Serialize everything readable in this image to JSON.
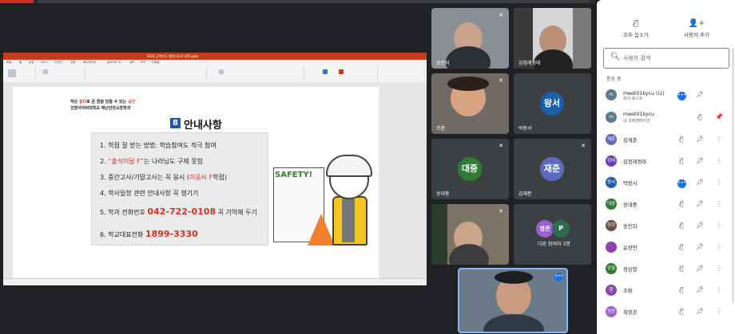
{
  "shared_screen": {
    "ppt_title": "2022_2학년도 행정사무과 개혁.pptx",
    "ribbon_tabs": [
      "파일",
      "홈",
      "삽입",
      "그리기",
      "디자인",
      "전환",
      "애니메이션",
      "슬라이드 쇼",
      "검토",
      "보기",
      "도움말"
    ],
    "slide": {
      "top_line1_a": "작은 ",
      "top_line1_red1": "흥미",
      "top_line1_b": "로 큰 꿈을 담을 수 있는 ",
      "top_line1_red2": "공간",
      "top_line2": "건양사이버대학교 재난안전소방학과",
      "section_number": "8",
      "title": "안내사항",
      "items": [
        {
          "n": "1.",
          "text": "학점 잘 받는 방법: 학습참여도 적극 참여"
        },
        {
          "n": "2.",
          "pre": "“출석미달 F”",
          "text": "는 나라님도 구제 못함"
        },
        {
          "n": "3.",
          "text": "중간고사/기말고사는 꼭 응시 (",
          "red": "미응시 F",
          "post": "학점)"
        },
        {
          "n": "4.",
          "text": "학사일정 관련 안내사항 꼭 챙기기"
        },
        {
          "n": "5.",
          "text": "학과 전화번호 ",
          "big": "042-722-0108",
          "post": " 꼭 기억해 두기"
        },
        {
          "n": "6.",
          "text": "학교대표전화 ",
          "big": "1899-3330"
        }
      ],
      "board_text": "SAFETY!"
    }
  },
  "tiles": [
    {
      "name": "송민석",
      "muted": true
    },
    {
      "name": "김정래정태",
      "muted": false
    },
    {
      "name": "조환",
      "muted": true
    },
    {
      "name": "박왕서",
      "muted": false,
      "avatar": "왕서",
      "avatar_color": "#1a5fa8"
    },
    {
      "name": "송대중",
      "muted": true,
      "avatar": "대중",
      "avatar_color": "#2e7d32"
    },
    {
      "name": "김재준",
      "muted": false,
      "avatar": "재준",
      "avatar_color": "#5c6bc0"
    },
    {
      "name": "",
      "muted": true
    },
    {
      "name": "다른 참여자 3명",
      "avatar_a": "영관",
      "avatar_b": "P"
    }
  ],
  "panel": {
    "mute_all": "모두 음소거",
    "add_user": "사용자 추가",
    "search_placeholder": "사용자 검색",
    "section_label": "통화 중",
    "participants": [
      {
        "initial": "m",
        "color": "#5f7a8a",
        "name": "meet01kycu (나)",
        "sub": "회의 호스트",
        "icons": [
          "more-blue",
          "pin",
          ""
        ]
      },
      {
        "initial": "m",
        "color": "#5f7a8a",
        "name": "meet01kycu",
        "sub": "내 프레젠테이션",
        "icons": [
          "",
          "mic-off",
          "pin-off"
        ]
      },
      {
        "initial": "재준",
        "color": "#5c6bc0",
        "name": "김재준",
        "icons": [
          "mic-off",
          "pin",
          "more"
        ]
      },
      {
        "initial": "정태",
        "color": "#6a3fb5",
        "name": "김정래정태",
        "icons": [
          "mic-off",
          "pin",
          "more"
        ]
      },
      {
        "initial": "왕서",
        "color": "#1a5fa8",
        "name": "박왕서",
        "icons": [
          "more-blue",
          "pin",
          "more"
        ]
      },
      {
        "initial": "대중",
        "color": "#2e7d32",
        "name": "송대중",
        "icons": [
          "mic-off",
          "pin",
          "more"
        ]
      },
      {
        "initial": "한희",
        "color": "#6d4c41",
        "name": "송한희",
        "icons": [
          "mic-off",
          "pin",
          "more"
        ]
      },
      {
        "initial": "",
        "color": "#8e44ad",
        "name": "윤광민",
        "icons": [
          "mic-off",
          "pin",
          "more"
        ]
      },
      {
        "initial": "상형",
        "color": "#2e7d32",
        "name": "정상형",
        "icons": [
          "mic-off",
          "pin",
          "more"
        ]
      },
      {
        "initial": "환",
        "color": "#8e44ad",
        "name": "조환",
        "icons": [
          "mic-off",
          "pin",
          "more"
        ]
      },
      {
        "initial": "영관",
        "color": "#9c5fcf",
        "name": "최영관",
        "icons": [
          "mic-off",
          "pin",
          "more"
        ]
      }
    ]
  }
}
